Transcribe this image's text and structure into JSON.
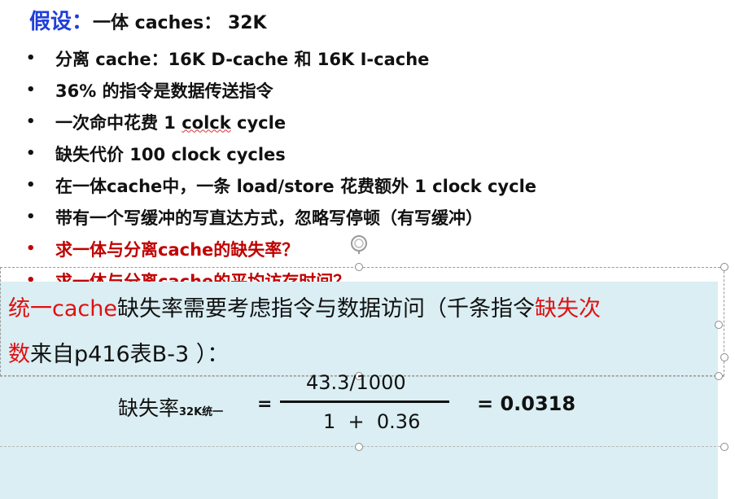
{
  "title": {
    "highlight": "假设：",
    "rest": "一体 caches： 32K"
  },
  "bullets": [
    {
      "text": "分离 cache：16K D-cache 和 16K I-cache",
      "red": false
    },
    {
      "text": "36% 的指令是数据传送指令",
      "red": false
    },
    {
      "prefix": "一次命中花费 1 ",
      "squiggle": "colck",
      "suffix": " cycle",
      "red": false
    },
    {
      "text": "缺失代价 100 clock cycles",
      "red": false
    },
    {
      "text": "在一体cache中，一条 load/store 花费额外 1 clock cycle",
      "red": false
    },
    {
      "text": "带有一个写缓冲的写直达方式，忽略写停顿（有写缓冲）",
      "red": false
    },
    {
      "text": "求一体与分离cache的缺失率？",
      "red": true
    },
    {
      "text": "求一体与分离cache的平均访存时间？",
      "red": true
    }
  ],
  "bullet_symbol": "•",
  "paragraph": {
    "line1_red1": "统一cache",
    "line1_black": "缺失率需要考虑指令与数据访问（千条指令",
    "line1_red2": "缺失次",
    "line2_red": "数",
    "line2_black": "来自p416表B-3 ）："
  },
  "formula": {
    "label": "缺失率",
    "subscript": "32K统一",
    "equals": "=",
    "numerator": "43.3/1000",
    "denominator": "1  +  0.36",
    "result": "= 0.0318"
  },
  "colors": {
    "title_blue": "#1f3fd8",
    "red": "#c00000",
    "panel_bg": "#daeef3"
  },
  "icons": {
    "cursor": "rotate-handle-icon"
  }
}
